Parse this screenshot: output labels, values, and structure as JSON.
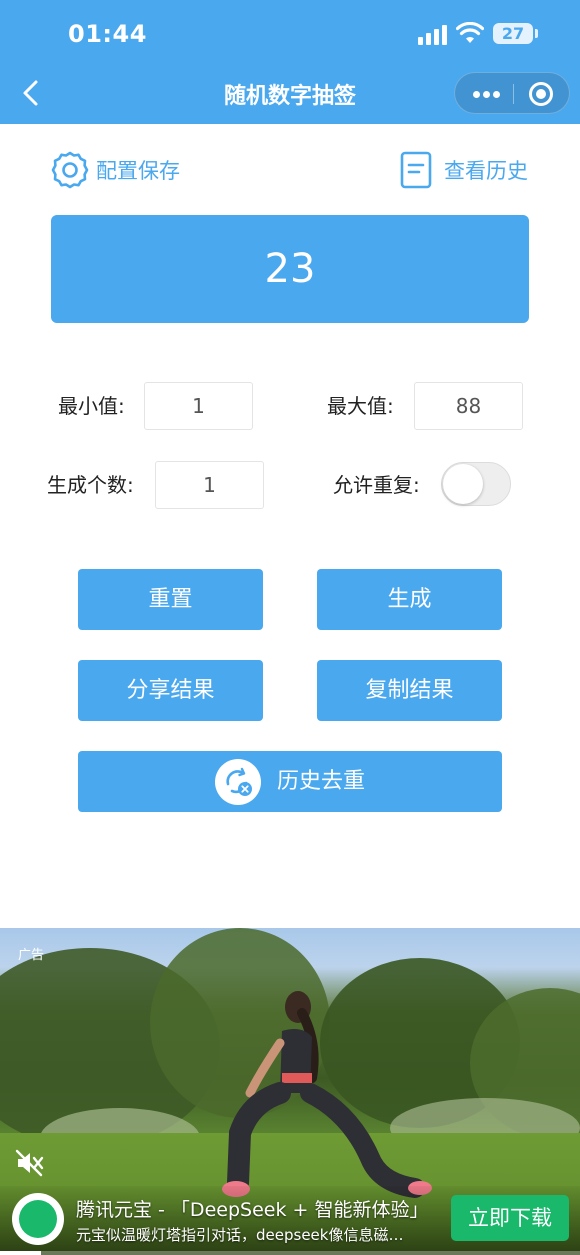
{
  "status_bar": {
    "time": "01:44",
    "battery": "27"
  },
  "nav": {
    "title": "随机数字抽签"
  },
  "toolbar": {
    "config_label": "配置保存",
    "history_label": "查看历史"
  },
  "result": {
    "value": "23"
  },
  "form": {
    "min_label": "最小值:",
    "min_value": "1",
    "max_label": "最大值:",
    "max_value": "88",
    "count_label": "生成个数:",
    "count_value": "1",
    "repeat_label": "允许重复:",
    "repeat_enabled": false
  },
  "buttons": {
    "reset": "重置",
    "generate": "生成",
    "share": "分享结果",
    "copy": "复制结果",
    "dedup": "历史去重"
  },
  "ad": {
    "tag": "广告",
    "title": "腾讯元宝 - 「DeepSeek + 智能新体验」",
    "subtitle": "元宝似温暖灯塔指引对话，deepseek像信息磁…",
    "cta": "立即下载",
    "progress": 0.07,
    "colors": {
      "cta": "#19b86b"
    }
  },
  "theme": {
    "primary": "#4aa8ef"
  }
}
